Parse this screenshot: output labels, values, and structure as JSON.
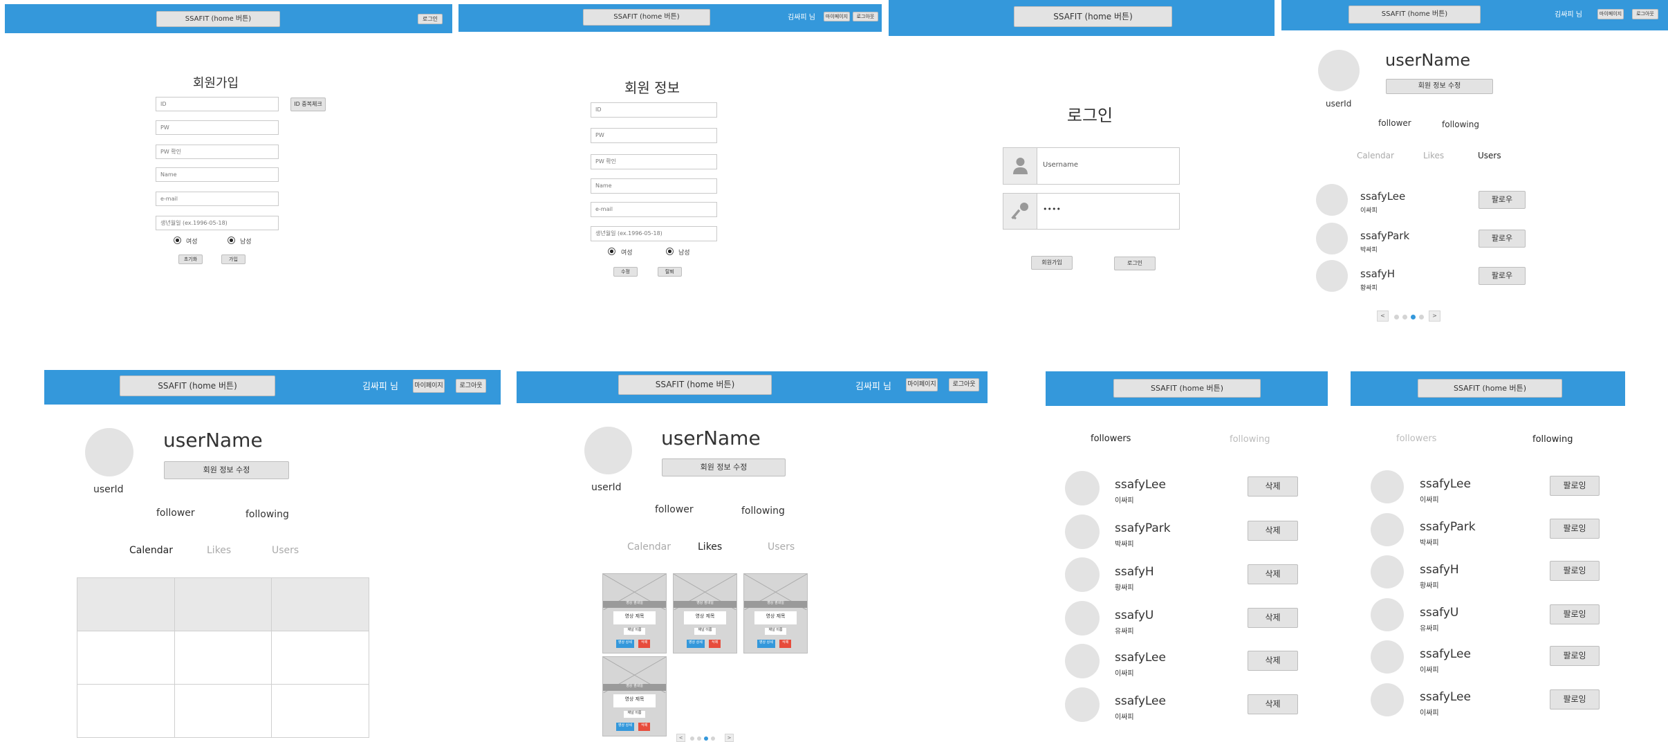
{
  "colors": {
    "accent": "#3498db",
    "button": "#e3e3e3",
    "avatar": "#e3e3e3",
    "delete": "#e74c3c"
  },
  "common": {
    "home": "SSAFIT (home 버튼)",
    "greeting": "김싸피 님",
    "mypage": "마이페이지",
    "logout": "로그아웃",
    "login": "로그인"
  },
  "signup": {
    "title": "회원가입",
    "id_placeholder": "ID",
    "id_check": "ID 중복체크",
    "pw_placeholder": "PW",
    "pw_confirm_placeholder": "PW 확인",
    "name_placeholder": "Name",
    "email_placeholder": "e-mail",
    "birth_placeholder": "생년월일 (ex.1996-05-18)",
    "female": "여성",
    "male": "남성",
    "reset": "초기화",
    "submit": "가입"
  },
  "profile_edit": {
    "title": "회원 정보",
    "id_placeholder": "ID",
    "pw_placeholder": "PW",
    "pw_confirm_placeholder": "PW 확인",
    "name_placeholder": "Name",
    "email_placeholder": "e-mail",
    "birth_placeholder": "생년월일 (ex.1996-05-18)",
    "female": "여성",
    "male": "남성",
    "edit": "수정",
    "withdraw": "탈퇴"
  },
  "login": {
    "title": "로그인",
    "username_placeholder": "Username",
    "password_value": "••••",
    "signup": "회원가입",
    "login": "로그인"
  },
  "mypage": {
    "username": "userName",
    "userid": "userId",
    "edit_info": "회원 정보 수정",
    "follower": "follower",
    "following": "following",
    "tabs": {
      "calendar": "Calendar",
      "likes": "Likes",
      "users": "Users"
    },
    "follow_button": "팔로우",
    "users": [
      {
        "name": "ssafyLee",
        "sub": "이싸피"
      },
      {
        "name": "ssafyPark",
        "sub": "박싸피"
      },
      {
        "name": "ssafyH",
        "sub": "황싸피"
      }
    ],
    "pagination": {
      "prev": "<",
      "next": ">",
      "pages": 4,
      "current": 3
    }
  },
  "likes": {
    "video_band": "영상 썸네일",
    "video_title": "영상 제목",
    "video_sub": "채널 이름",
    "detail_button": "영상 상세",
    "delete_button": "삭제",
    "cards": 4,
    "pagination": {
      "prev": "<",
      "next": ">",
      "pages": 4,
      "current": 3
    }
  },
  "followers_page": {
    "tab_followers": "followers",
    "tab_following": "following",
    "delete_button": "삭제",
    "users": [
      {
        "name": "ssafyLee",
        "sub": "이싸피"
      },
      {
        "name": "ssafyPark",
        "sub": "박싸피"
      },
      {
        "name": "ssafyH",
        "sub": "황싸피"
      },
      {
        "name": "ssafyU",
        "sub": "유싸피"
      },
      {
        "name": "ssafyLee",
        "sub": "이싸피"
      },
      {
        "name": "ssafyLee",
        "sub": "이싸피"
      }
    ]
  },
  "following_page": {
    "tab_followers": "followers",
    "tab_following": "following",
    "following_button": "팔로잉",
    "users": [
      {
        "name": "ssafyLee",
        "sub": "이싸피"
      },
      {
        "name": "ssafyPark",
        "sub": "박싸피"
      },
      {
        "name": "ssafyH",
        "sub": "황싸피"
      },
      {
        "name": "ssafyU",
        "sub": "유싸피"
      },
      {
        "name": "ssafyLee",
        "sub": "이싸피"
      },
      {
        "name": "ssafyLee",
        "sub": "이싸피"
      }
    ]
  }
}
